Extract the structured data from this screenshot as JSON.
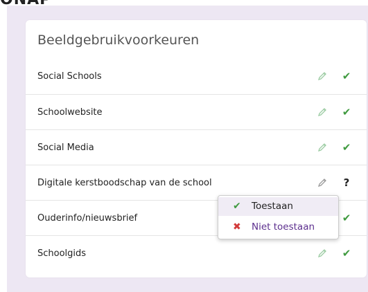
{
  "header_fragment": "ONAP",
  "card": {
    "title": "Beeldgebruikvoorkeuren"
  },
  "rows": [
    {
      "label": "Social Schools",
      "status": "✔",
      "status_kind": "allowed"
    },
    {
      "label": "Schoolwebsite",
      "status": "✔",
      "status_kind": "allowed"
    },
    {
      "label": "Social Media",
      "status": "✔",
      "status_kind": "allowed"
    },
    {
      "label": "Digitale kerstboodschap van de school",
      "status": "?",
      "status_kind": "unknown"
    },
    {
      "label": "Ouderinfo/nieuwsbrief",
      "status": "✔",
      "status_kind": "allowed"
    },
    {
      "label": "Schoolgids",
      "status": "✔",
      "status_kind": "allowed"
    }
  ],
  "dropdown": {
    "options": [
      {
        "icon": "✔",
        "label": "Toestaan"
      },
      {
        "icon": "✖",
        "label": "Niet toestaan"
      }
    ]
  },
  "colors": {
    "background": "#ede7f3",
    "check_green": "#3f9a3f",
    "cross_red": "#d23a3a",
    "accent_purple": "#5c2f8e",
    "pencil_green": "#9ccca3"
  },
  "icons": {
    "edit": "pencil-icon",
    "allowed": "check-icon",
    "unknown": "question-icon",
    "deny": "cross-icon"
  }
}
